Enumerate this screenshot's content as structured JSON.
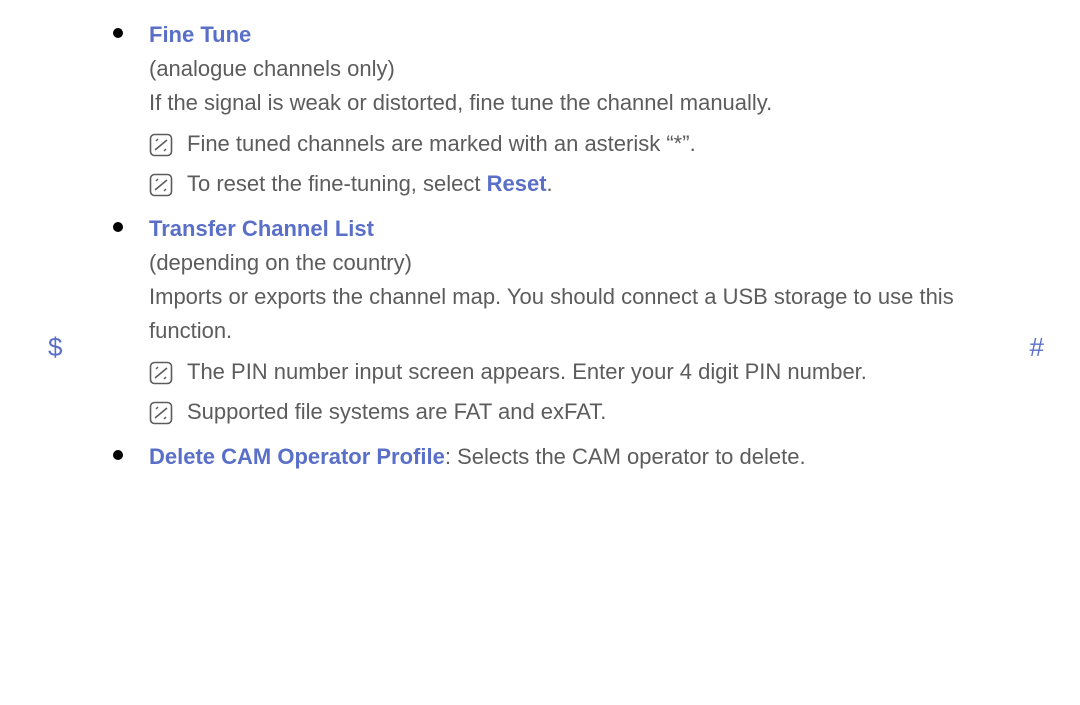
{
  "nav": {
    "prev": "$",
    "next": "#"
  },
  "sections": {
    "fineTune": {
      "title": "Fine Tune",
      "subtitle": "(analogue channels only)",
      "body": "If the signal is weak or distorted, fine tune the channel manually.",
      "notes": [
        "Fine tuned channels are marked with an asterisk “*”.",
        "To reset the fine-tuning, select "
      ],
      "resetLabel": "Reset",
      "resetSuffix": "."
    },
    "transfer": {
      "title": "Transfer Channel List",
      "subtitle": "(depending on the country)",
      "body": "Imports or exports the channel map. You should connect a USB storage to use this function.",
      "notes": [
        "The PIN number input screen appears. Enter your 4 digit PIN number.",
        "Supported file systems are FAT and exFAT."
      ]
    },
    "deleteCam": {
      "title": "Delete CAM Operator Profile",
      "suffix": ": Selects the CAM operator to delete."
    }
  }
}
